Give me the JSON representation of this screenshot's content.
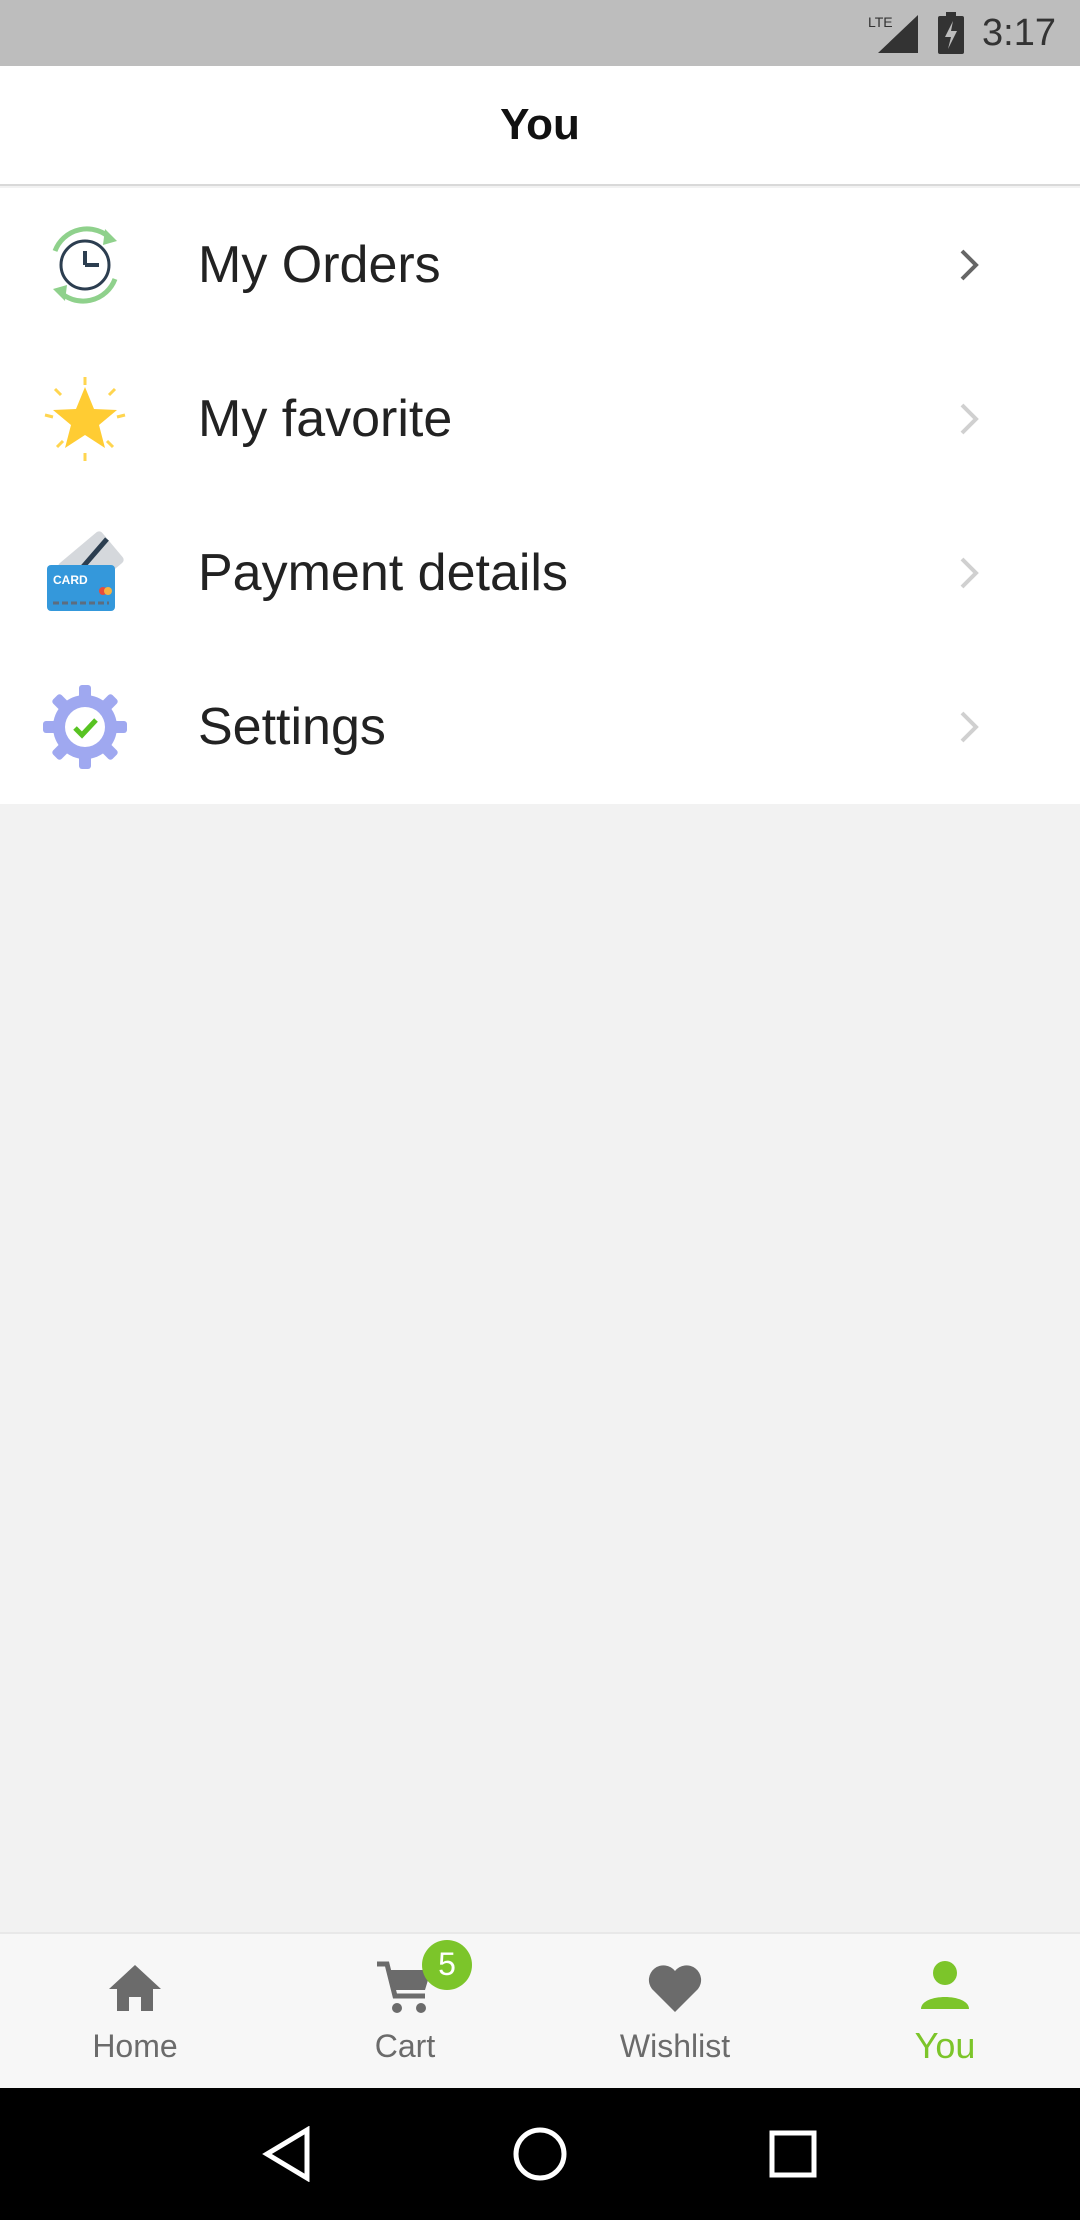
{
  "status_bar": {
    "network": "LTE",
    "time": "3:17"
  },
  "header": {
    "title": "You"
  },
  "menu": [
    {
      "label": "My Orders",
      "icon": "orders-clock-icon"
    },
    {
      "label": "My favorite",
      "icon": "star-icon"
    },
    {
      "label": "Payment details",
      "icon": "credit-card-icon",
      "card_text": "CARD"
    },
    {
      "label": "Settings",
      "icon": "settings-gear-icon"
    }
  ],
  "bottom_nav": {
    "items": [
      {
        "label": "Home",
        "icon": "home-icon"
      },
      {
        "label": "Cart",
        "icon": "cart-icon",
        "badge": "5"
      },
      {
        "label": "Wishlist",
        "icon": "heart-icon"
      },
      {
        "label": "You",
        "icon": "person-icon",
        "active": true
      }
    ]
  },
  "colors": {
    "accent": "#7cc52a",
    "header_bg": "#ffffff",
    "page_bg": "#f2f2f2",
    "status_bar_bg": "#bdbdbd"
  }
}
